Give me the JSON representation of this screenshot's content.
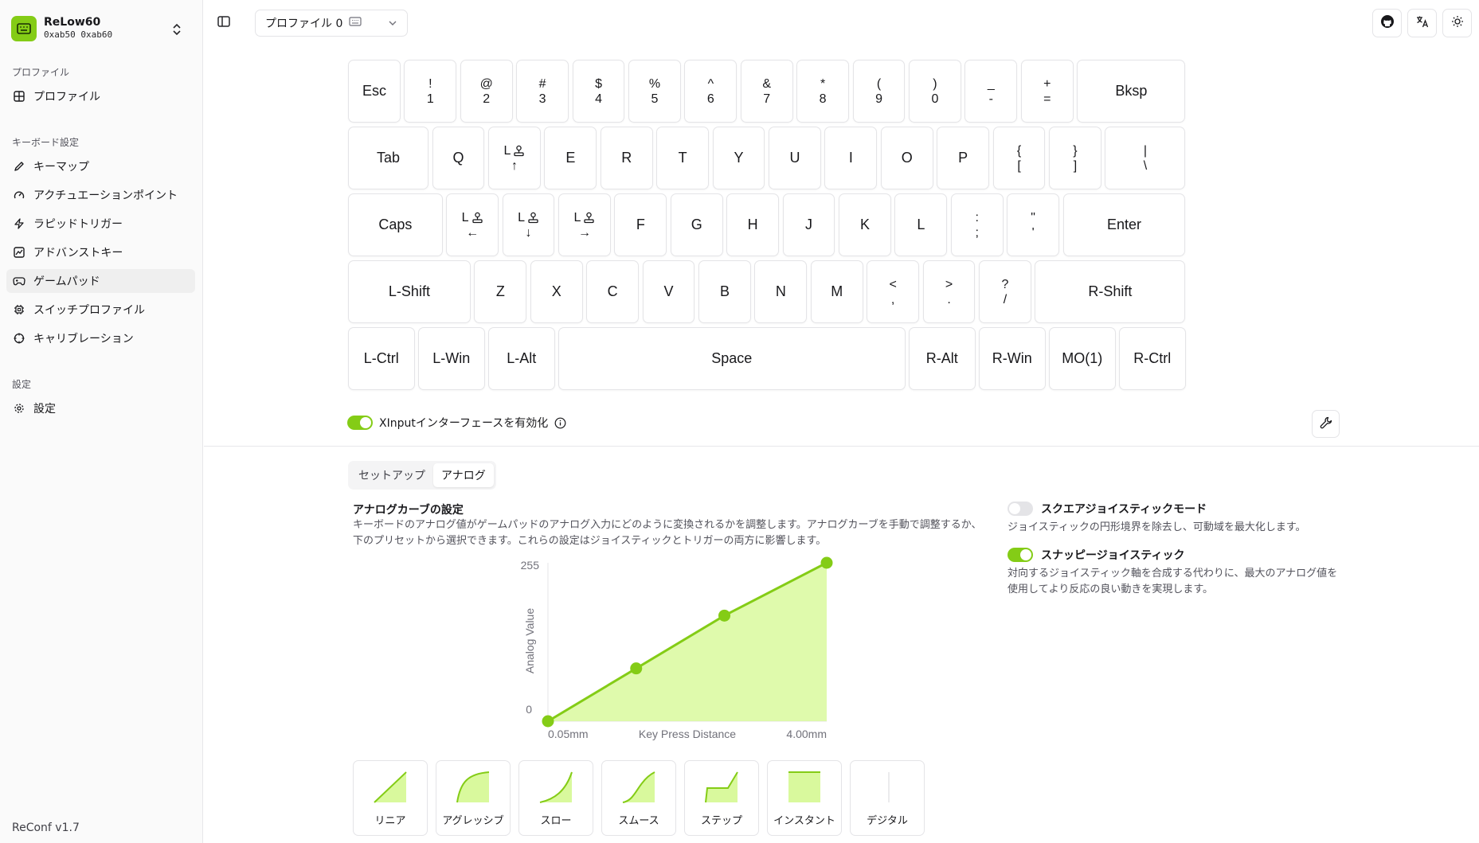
{
  "app": {
    "device_name": "ReLow60",
    "device_id": "0xab50 0xab60",
    "version": "ReConf v1.7"
  },
  "sidebar": {
    "groups": [
      {
        "label": "プロファイル",
        "items": [
          {
            "label": "プロファイル",
            "icon": "grid-icon"
          }
        ]
      },
      {
        "label": "キーボード設定",
        "items": [
          {
            "label": "キーマップ",
            "icon": "pencil-icon"
          },
          {
            "label": "アクチュエーションポイント",
            "icon": "gauge-icon"
          },
          {
            "label": "ラピッドトリガー",
            "icon": "zap-icon"
          },
          {
            "label": "アドバンストキー",
            "icon": "chart-icon"
          },
          {
            "label": "ゲームパッド",
            "icon": "gamepad-icon",
            "active": true
          },
          {
            "label": "スイッチプロファイル",
            "icon": "chip-icon"
          },
          {
            "label": "キャリブレーション",
            "icon": "crosshair-icon"
          }
        ]
      },
      {
        "label": "設定",
        "items": [
          {
            "label": "設定",
            "icon": "gear-icon"
          }
        ]
      }
    ]
  },
  "topbar": {
    "profile_label": "プロファイル 0"
  },
  "keyboard": {
    "rows": [
      [
        {
          "l": "Esc"
        },
        {
          "t": "!",
          "b": "1"
        },
        {
          "t": "@",
          "b": "2"
        },
        {
          "t": "#",
          "b": "3"
        },
        {
          "t": "$",
          "b": "4"
        },
        {
          "t": "%",
          "b": "5"
        },
        {
          "t": "^",
          "b": "6"
        },
        {
          "t": "&",
          "b": "7"
        },
        {
          "t": "*",
          "b": "8"
        },
        {
          "t": "(",
          "b": "9"
        },
        {
          "t": ")",
          "b": "0"
        },
        {
          "t": "_",
          "b": "-"
        },
        {
          "t": "+",
          "b": "="
        },
        {
          "l": "Bksp"
        }
      ],
      [
        {
          "l": "Tab"
        },
        {
          "l": "Q"
        },
        {
          "t": "L",
          "b": "↑",
          "stick": true
        },
        {
          "l": "E"
        },
        {
          "l": "R"
        },
        {
          "l": "T"
        },
        {
          "l": "Y"
        },
        {
          "l": "U"
        },
        {
          "l": "I"
        },
        {
          "l": "O"
        },
        {
          "l": "P"
        },
        {
          "t": "{",
          "b": "["
        },
        {
          "t": "}",
          "b": "]"
        },
        {
          "t": "|",
          "b": "\\"
        }
      ],
      [
        {
          "l": "Caps"
        },
        {
          "t": "L",
          "b": "←",
          "stick": true
        },
        {
          "t": "L",
          "b": "↓",
          "stick": true
        },
        {
          "t": "L",
          "b": "→",
          "stick": true
        },
        {
          "l": "F"
        },
        {
          "l": "G"
        },
        {
          "l": "H"
        },
        {
          "l": "J"
        },
        {
          "l": "K"
        },
        {
          "l": "L"
        },
        {
          "t": ":",
          "b": ";"
        },
        {
          "t": "\"",
          "b": "'"
        },
        {
          "l": "Enter"
        }
      ],
      [
        {
          "l": "L-Shift"
        },
        {
          "l": "Z"
        },
        {
          "l": "X"
        },
        {
          "l": "C"
        },
        {
          "l": "V"
        },
        {
          "l": "B"
        },
        {
          "l": "N"
        },
        {
          "l": "M"
        },
        {
          "t": "<",
          "b": ","
        },
        {
          "t": ">",
          "b": "."
        },
        {
          "t": "?",
          "b": "/"
        },
        {
          "l": "R-Shift"
        }
      ],
      [
        {
          "l": "L-Ctrl"
        },
        {
          "l": "L-Win"
        },
        {
          "l": "L-Alt"
        },
        {
          "l": "Space"
        },
        {
          "l": "R-Alt"
        },
        {
          "l": "R-Win"
        },
        {
          "l": "MO(1)"
        },
        {
          "l": "R-Ctrl"
        }
      ]
    ]
  },
  "xinput": {
    "label": "XInputインターフェースを有効化",
    "enabled": true
  },
  "tabs": [
    {
      "label": "セットアップ",
      "active": false
    },
    {
      "label": "アナログ",
      "active": true
    }
  ],
  "analog": {
    "title": "アナログカーブの設定",
    "description": "キーボードのアナログ値がゲームパッドのアナログ入力にどのように変換されるかを調整します。アナログカーブを手動で調整するか、下のプリセットから選択できます。これらの設定はジョイスティックとトリガーの両方に影響します。"
  },
  "chart_data": {
    "type": "area",
    "xlabel": "Key Press Distance",
    "ylabel": "Analog Value",
    "x_tick_labels": [
      "0.05mm",
      "4.00mm"
    ],
    "y_tick_labels": [
      "0",
      "255"
    ],
    "xlim": [
      0.05,
      4.0
    ],
    "ylim": [
      0,
      255
    ],
    "x": [
      0.05,
      1.3,
      2.55,
      4.0
    ],
    "y": [
      0,
      85,
      170,
      255
    ],
    "color": "#84cc16"
  },
  "options": [
    {
      "title": "スクエアジョイスティックモード",
      "desc": "ジョイスティックの円形境界を除去し、可動域を最大化します。",
      "enabled": false
    },
    {
      "title": "スナッピージョイスティック",
      "desc": "対向するジョイスティック軸を合成する代わりに、最大のアナログ値を使用してより反応の良い動きを実現します。",
      "enabled": true
    }
  ],
  "presets": [
    {
      "label": "リニア",
      "icon": "linear-curve-icon"
    },
    {
      "label": "アグレッシブ",
      "icon": "aggressive-curve-icon"
    },
    {
      "label": "スロー",
      "icon": "slow-curve-icon"
    },
    {
      "label": "スムース",
      "icon": "smooth-curve-icon"
    },
    {
      "label": "ステップ",
      "icon": "step-curve-icon"
    },
    {
      "label": "インスタント",
      "icon": "instant-curve-icon"
    },
    {
      "label": "デジタル",
      "icon": "digital-curve-icon"
    }
  ],
  "colors": {
    "accent": "#84cc16",
    "accent_fill": "#d9f99d"
  }
}
